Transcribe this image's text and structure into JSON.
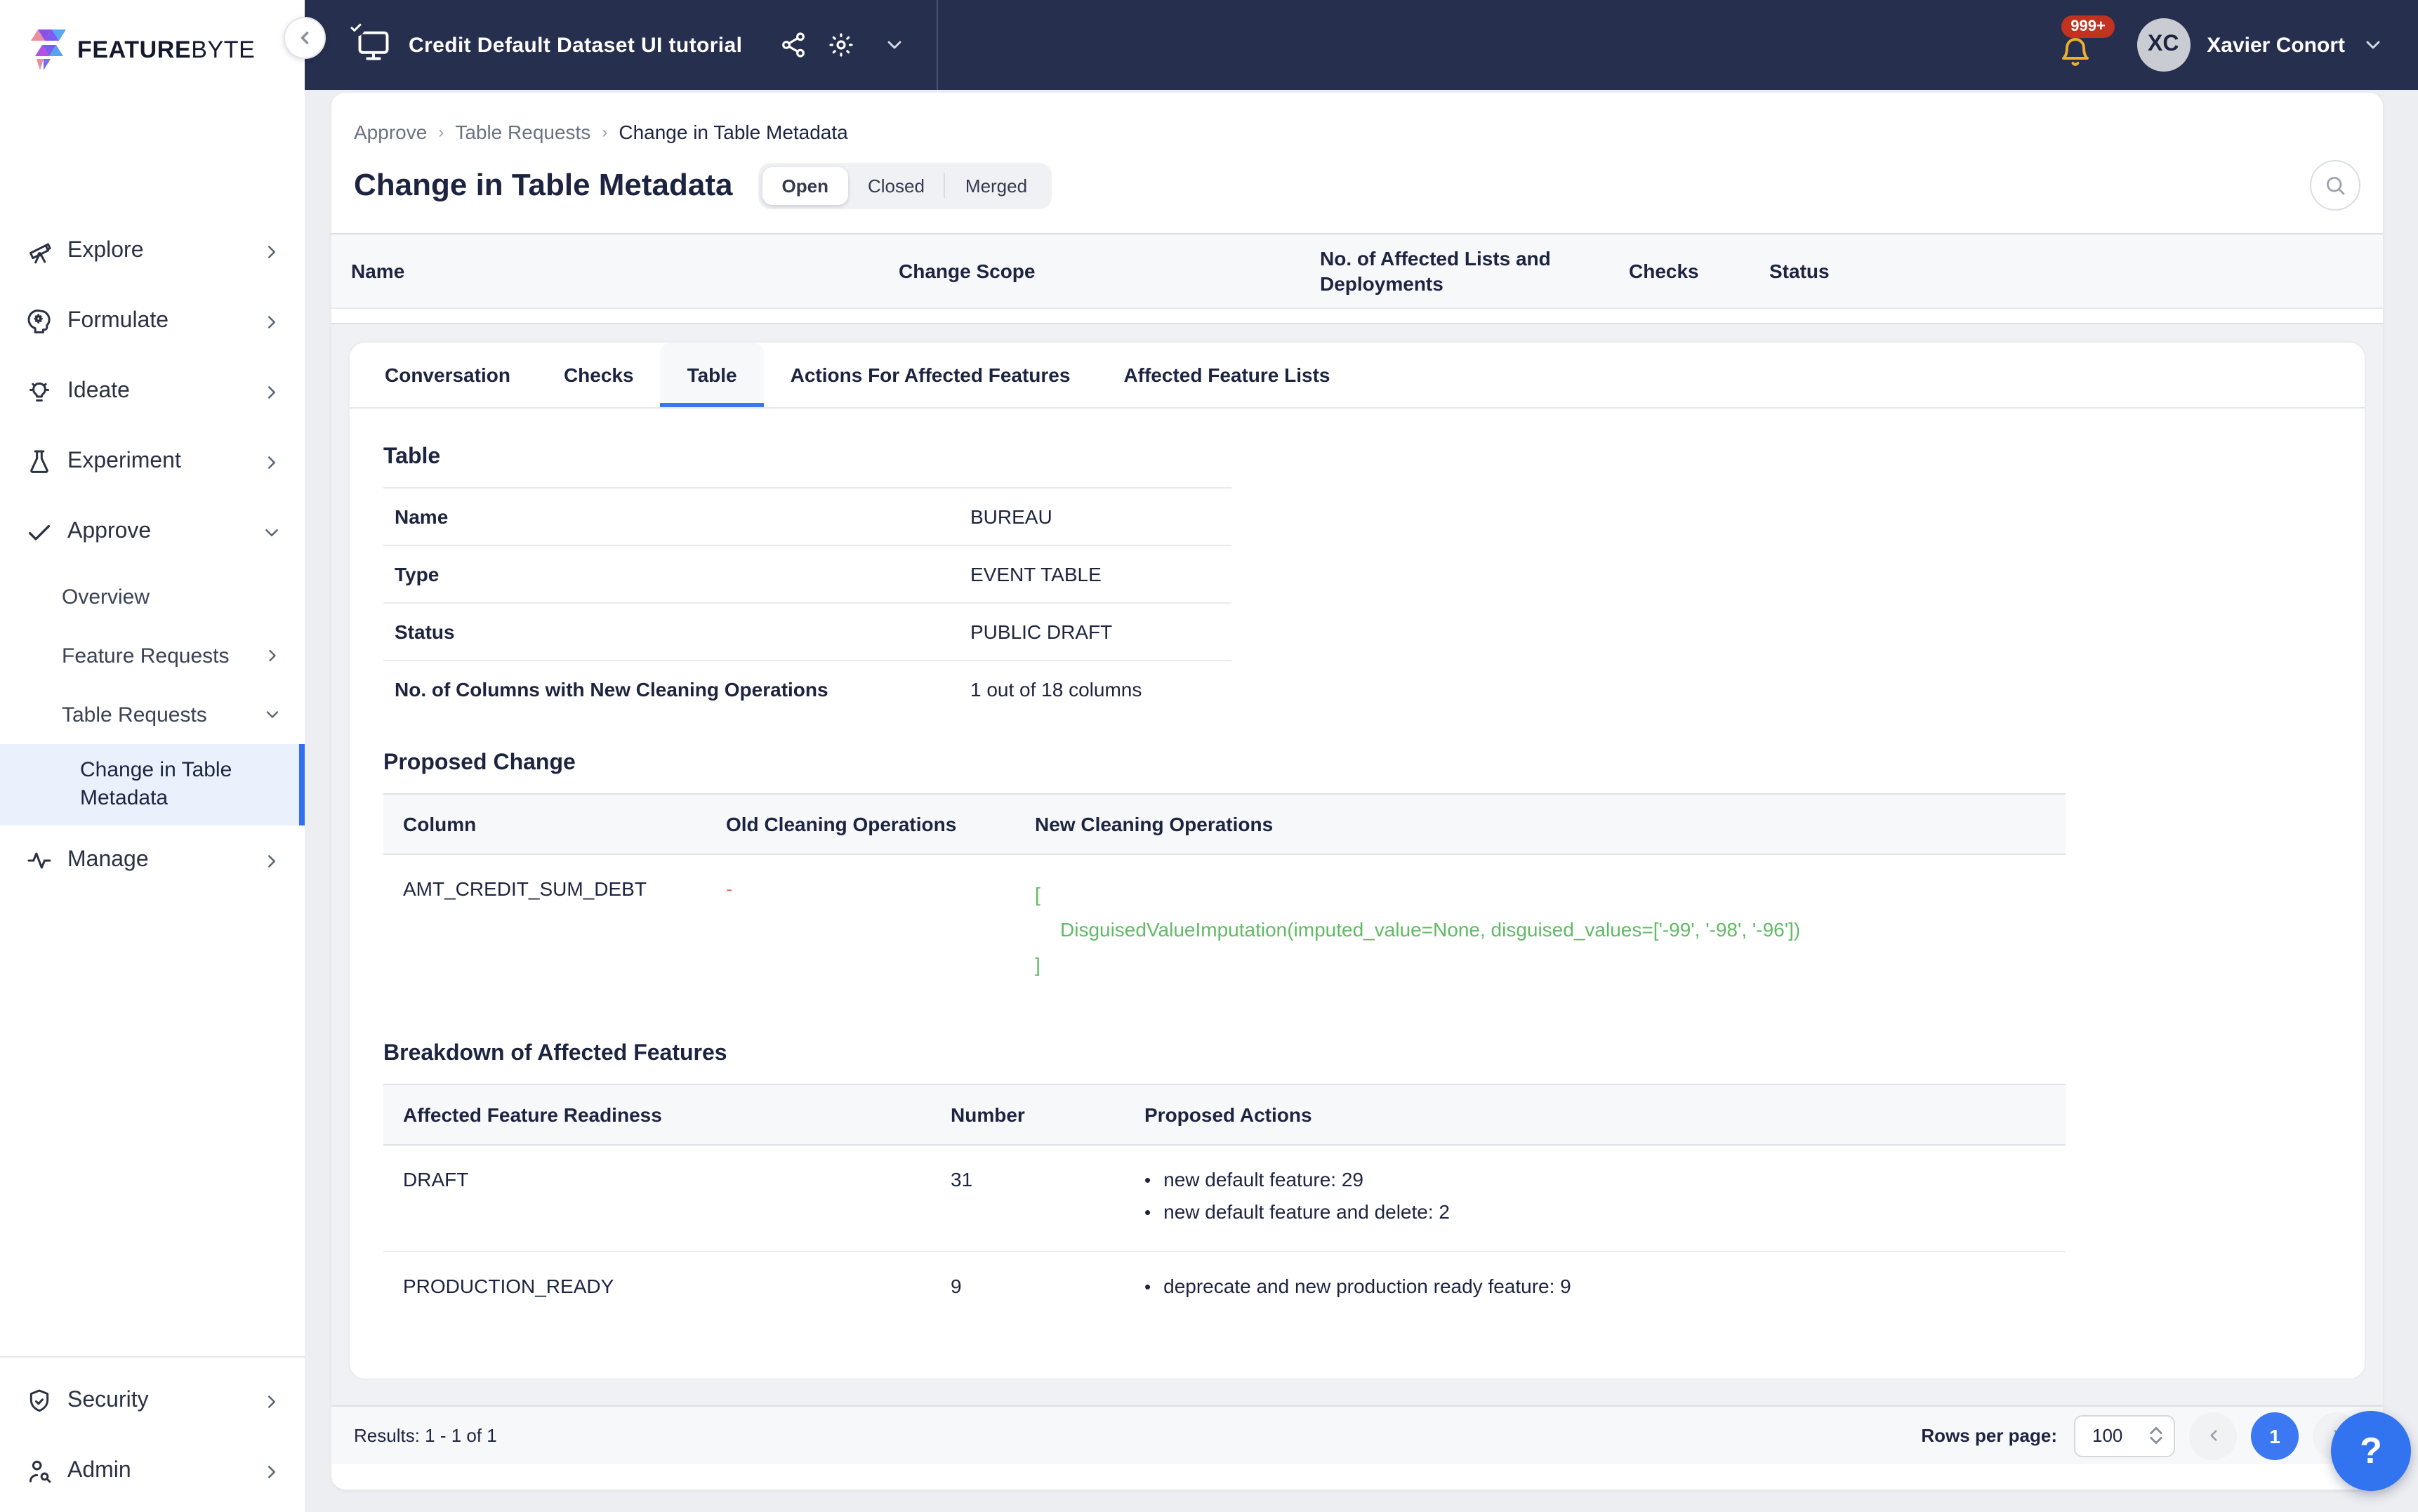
{
  "topbar": {
    "logo_feature": "FEATURE",
    "logo_byte": "BYTE",
    "project_title": "Credit Default Dataset UI tutorial",
    "notifications_badge": "999+",
    "user_initials": "XC",
    "user_name": "Xavier Conort"
  },
  "sidebar": {
    "items": [
      {
        "label": "Explore"
      },
      {
        "label": "Formulate"
      },
      {
        "label": "Ideate"
      },
      {
        "label": "Experiment"
      },
      {
        "label": "Approve"
      }
    ],
    "approve_children": [
      {
        "label": "Overview"
      },
      {
        "label": "Feature Requests"
      },
      {
        "label": "Table Requests"
      }
    ],
    "table_requests_children": [
      {
        "label": "Change in Table Metadata"
      }
    ],
    "bottom_items": [
      {
        "label": "Security"
      },
      {
        "label": "Admin"
      }
    ]
  },
  "breadcrumb": {
    "items": [
      "Approve",
      "Table Requests",
      "Change in Table Metadata"
    ]
  },
  "page": {
    "title": "Change in Table Metadata",
    "filters": [
      "Open",
      "Closed",
      "Merged"
    ],
    "active_filter": "Open"
  },
  "request_table": {
    "columns": [
      "Name",
      "Change Scope",
      "No. of Affected Lists and Deployments",
      "Checks",
      "Status"
    ]
  },
  "detail": {
    "tabs": [
      "Conversation",
      "Checks",
      "Table",
      "Actions For Affected Features",
      "Affected Feature Lists"
    ],
    "active_tab": "Table",
    "table_section": {
      "heading": "Table",
      "rows": [
        {
          "label": "Name",
          "value": "BUREAU"
        },
        {
          "label": "Type",
          "value": "EVENT TABLE"
        },
        {
          "label": "Status",
          "value": "PUBLIC DRAFT"
        },
        {
          "label": "No. of Columns with New Cleaning Operations",
          "value": "1 out of 18 columns"
        }
      ]
    },
    "proposed_change": {
      "heading": "Proposed Change",
      "columns": [
        "Column",
        "Old Cleaning Operations",
        "New Cleaning Operations"
      ],
      "row": {
        "column": "AMT_CREDIT_SUM_DEBT",
        "old": "-",
        "new_open": "[",
        "new_code": "DisguisedValueImputation(imputed_value=None, disguised_values=['-99', '-98', '-96'])",
        "new_close": "]"
      }
    },
    "breakdown": {
      "heading": "Breakdown of Affected Features",
      "columns": [
        "Affected Feature Readiness",
        "Number",
        "Proposed Actions"
      ],
      "rows": [
        {
          "readiness": "DRAFT",
          "number": "31",
          "actions": [
            "new default feature: 29",
            "new default feature and delete: 2"
          ]
        },
        {
          "readiness": "PRODUCTION_READY",
          "number": "9",
          "actions": [
            "deprecate and new production ready feature: 9"
          ]
        }
      ]
    }
  },
  "footer": {
    "results": "Results: 1 - 1 of 1",
    "rows_per_page_label": "Rows per page:",
    "rows_per_page_value": "100",
    "current_page": "1",
    "help_label": "?"
  },
  "colors": {
    "topbar": "#262f4e",
    "accent_blue": "#3b76f0",
    "code_green": "#5fbb63",
    "old_dash_red": "#e5695e",
    "badge_red": "#c1331f",
    "bell_amber": "#efae2c",
    "selected_nav_bg": "#e9f1fd"
  }
}
